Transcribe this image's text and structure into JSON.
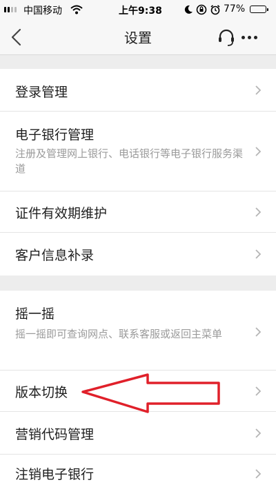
{
  "status_bar": {
    "carrier": "中国移动",
    "time": "上午9:38",
    "battery": "77%",
    "battery_level": 0.77
  },
  "nav": {
    "title": "设置"
  },
  "groups": [
    {
      "items": [
        {
          "label": "登录管理"
        },
        {
          "label": "电子银行管理",
          "subtitle": "注册及管理网上银行、电话银行等电子银行服务渠道"
        },
        {
          "label": "证件有效期维护"
        },
        {
          "label": "客户信息补录"
        }
      ]
    },
    {
      "items": [
        {
          "label": "摇一摇",
          "subtitle": "摇一摇即可查询网点、联系客服或返回主菜单"
        },
        {
          "label": "版本切换"
        },
        {
          "label": "营销代码管理"
        },
        {
          "label": "注销电子银行"
        }
      ]
    }
  ],
  "colors": {
    "background": "#ededed",
    "annotation_arrow": "#e0202a"
  },
  "icons": {
    "back": "chevron-left-icon",
    "service": "headset-icon",
    "more": "more-dots-icon",
    "item": "chevron-right-icon"
  }
}
